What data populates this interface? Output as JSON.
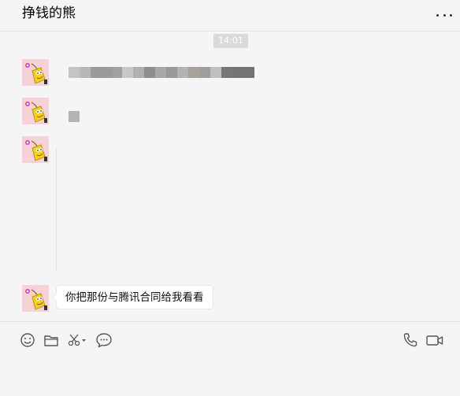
{
  "chat": {
    "title": "挣钱的熊",
    "time": "14:01"
  },
  "messages": [
    {
      "type": "redacted-text"
    },
    {
      "type": "redacted-text"
    },
    {
      "type": "blank"
    },
    {
      "type": "text",
      "text": "你把那份与腾讯合同给我看看"
    }
  ],
  "mosaic_colors": [
    "#c4c4c4",
    "#b7b7b7",
    "#9a9a9a",
    "#a0a0a0",
    "#c8c8c8",
    "#b0b0b0",
    "#8e8e8e",
    "#a8a8a8",
    "#999999",
    "#b2b2b2",
    "#a7a39a",
    "#9e9e9e",
    "#c0c0c0",
    "#767676",
    "#737373"
  ],
  "toolbar": {
    "left_icons": [
      "emoji-icon",
      "folder-icon",
      "scissors-icon",
      "chat-bubble-icon"
    ],
    "right_icons": [
      "phone-icon",
      "video-call-icon"
    ]
  },
  "colors": {
    "background": "#f5f5f5",
    "bubble": "#ffffff",
    "timestamp_bg": "#dadada",
    "avatar_bg": "#f6d2d6"
  }
}
